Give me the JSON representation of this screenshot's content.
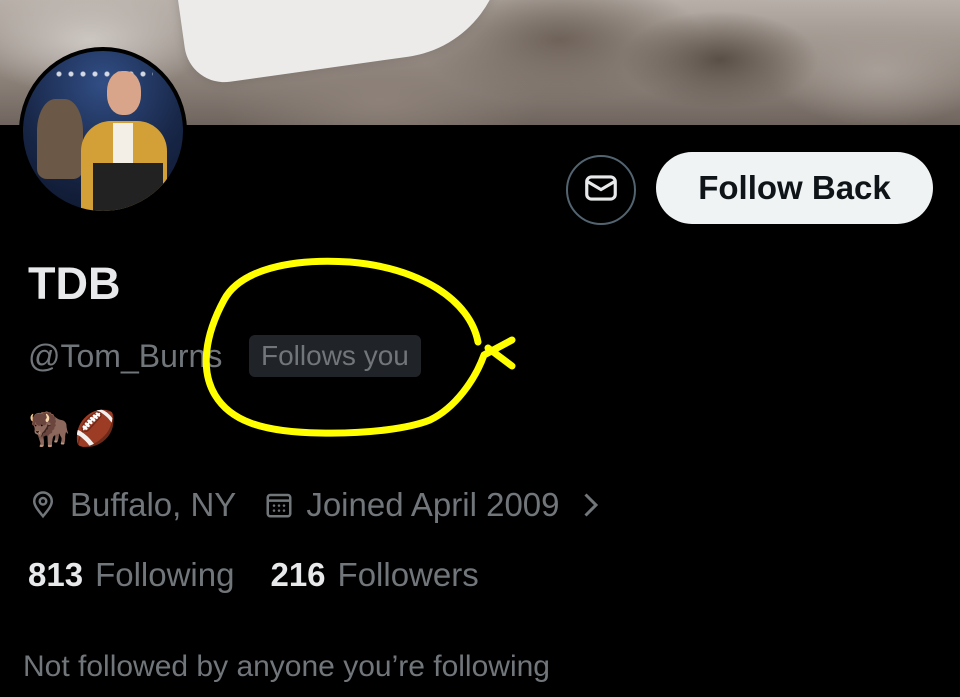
{
  "profile": {
    "display_name": "TDB",
    "handle": "@Tom_Burns",
    "follows_you_badge": "Follows you",
    "bio": "🦬🏈",
    "location": "Buffalo, NY",
    "joined": "Joined April 2009",
    "following_count": "813",
    "following_label": "Following",
    "followers_count": "216",
    "followers_label": "Followers",
    "mutuals_note": "Not followed by anyone you’re following"
  },
  "actions": {
    "follow_back_label": "Follow Back",
    "message_icon": "mail-icon"
  },
  "icons": {
    "location": "location-pin-icon",
    "calendar": "calendar-icon",
    "chevron": "chevron-right-icon"
  },
  "annotation": {
    "color": "#ffff00"
  },
  "colors": {
    "background": "#000000",
    "primary_text": "#e7e9ea",
    "secondary_text": "#71767b",
    "button_bg": "#eff3f4"
  }
}
